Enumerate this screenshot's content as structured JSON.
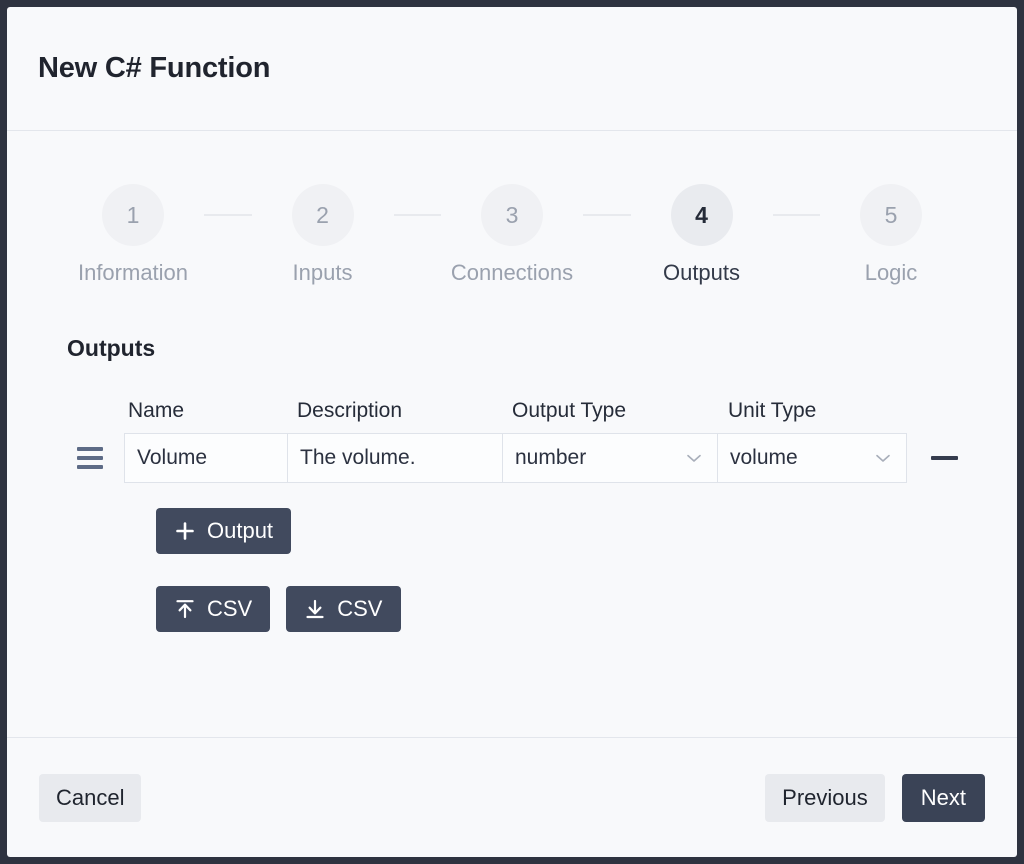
{
  "dialog": {
    "title": "New C# Function"
  },
  "stepper": {
    "steps": [
      {
        "number": "1",
        "label": "Information",
        "active": false
      },
      {
        "number": "2",
        "label": "Inputs",
        "active": false
      },
      {
        "number": "3",
        "label": "Connections",
        "active": false
      },
      {
        "number": "4",
        "label": "Outputs",
        "active": true
      },
      {
        "number": "5",
        "label": "Logic",
        "active": false
      }
    ]
  },
  "section": {
    "title": "Outputs"
  },
  "table": {
    "headers": {
      "name": "Name",
      "description": "Description",
      "output_type": "Output Type",
      "unit_type": "Unit Type"
    },
    "rows": [
      {
        "name": "Volume",
        "description": "The volume.",
        "output_type": "number",
        "unit_type": "volume",
        "drag_handle_icon": "drag-handle-icon",
        "remove_icon": "minus-icon"
      }
    ]
  },
  "actions": {
    "add_output_label": "Output",
    "add_output_icon": "plus-icon",
    "import_csv_label": "CSV",
    "import_csv_icon": "upload-icon",
    "export_csv_label": "CSV",
    "export_csv_icon": "download-icon"
  },
  "footer": {
    "cancel_label": "Cancel",
    "previous_label": "Previous",
    "next_label": "Next"
  },
  "colors": {
    "backdrop": "#2e3340",
    "surface": "#f8f9fb",
    "accent_dark": "#3a4356",
    "button_dark": "#414a5e",
    "button_light": "#e8eaee",
    "text_dark": "#20242e",
    "text_muted": "#9aa1ae",
    "border": "#dfe3ea",
    "handle": "#5d6b86"
  }
}
